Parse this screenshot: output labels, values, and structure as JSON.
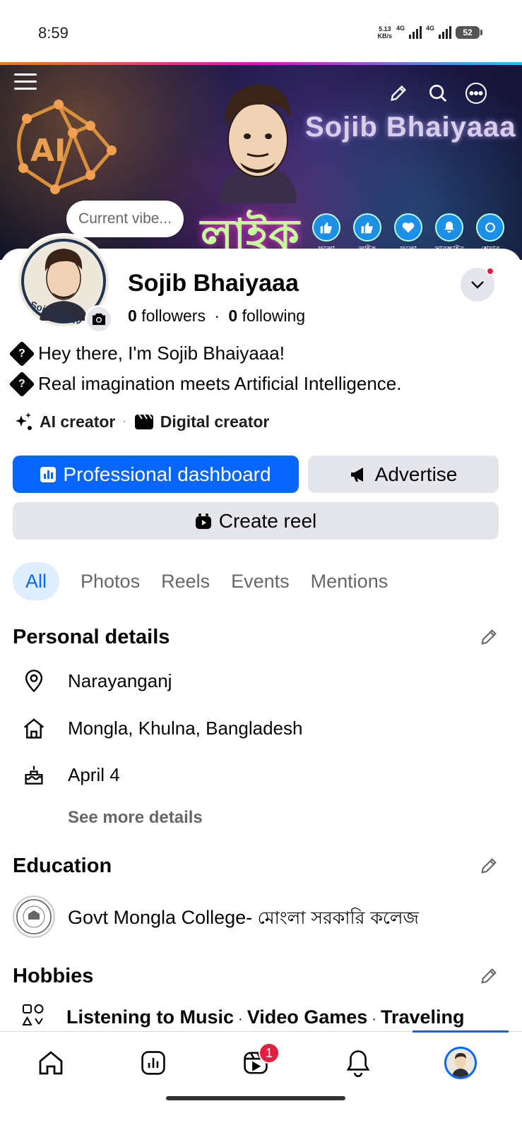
{
  "status_bar": {
    "time": "8:59",
    "net_speed_value": "5.13",
    "net_speed_unit": "KB/s",
    "signal_1": "4G",
    "signal_2": "4G",
    "battery": "52"
  },
  "cover": {
    "name_text": "Sojib Bhaiyaaa",
    "like_text": "লাইক",
    "ai_text": "AI",
    "buttons": [
      {
        "label": "ফলো",
        "icon": "thumbs-up-icon"
      },
      {
        "label": "লাইক",
        "icon": "thumbs-up-icon"
      },
      {
        "label": "ফলো",
        "icon": "heart-icon"
      },
      {
        "label": "সাবস্ক্রাইব",
        "icon": "bell-icon"
      },
      {
        "label": "শেয়ার",
        "icon": "share-icon"
      }
    ]
  },
  "vibe": {
    "placeholder": "Current vibe..."
  },
  "profile": {
    "name": "Sojib Bhaiyaaa",
    "followers_count": "0",
    "followers_label": "followers",
    "following_count": "0",
    "following_label": "following",
    "avatar_caption": "Sojib Bhaiy"
  },
  "bio": {
    "line1": "Hey there, I'm Sojib Bhaiyaaa!",
    "line2": "Real imagination meets Artificial Intelligence.",
    "glyph": "?"
  },
  "categories": [
    "AI creator",
    "Digital creator"
  ],
  "actions": {
    "dashboard": "Professional dashboard",
    "advertise": "Advertise",
    "create_reel": "Create reel"
  },
  "tabs": [
    "All",
    "Photos",
    "Reels",
    "Events",
    "Mentions"
  ],
  "personal_details": {
    "title": "Personal details",
    "location": "Narayanganj",
    "hometown": "Mongla, Khulna, Bangladesh",
    "birthday": "April 4",
    "see_more": "See more details"
  },
  "education": {
    "title": "Education",
    "school_en": "Govt Mongla College- ",
    "school_bn": "মোংলা সরকারি কলেজ"
  },
  "hobbies": {
    "title": "Hobbies",
    "items": [
      "Listening to Music",
      "Video Games",
      "Traveling"
    ]
  },
  "bottom_nav": {
    "reels_badge": "1"
  },
  "colors": {
    "accent": "#0866ff",
    "badge": "#e41e3f",
    "secondary_button": "#e4e6eb"
  }
}
